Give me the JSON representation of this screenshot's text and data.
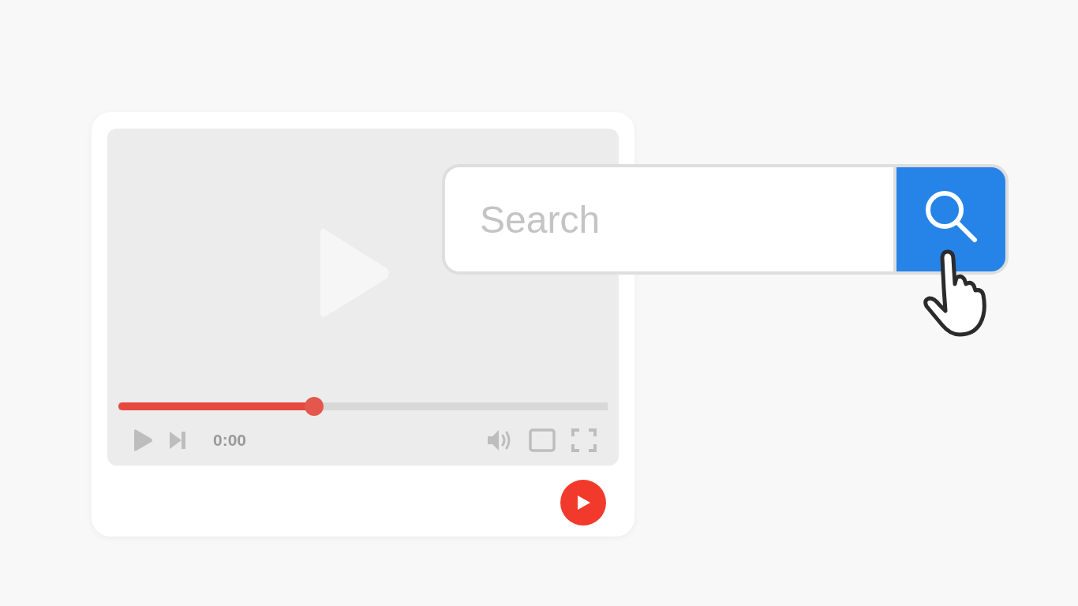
{
  "player": {
    "progress": {
      "level": 0.4
    },
    "time": "0:00"
  },
  "search": {
    "placeholder": "Search"
  }
}
